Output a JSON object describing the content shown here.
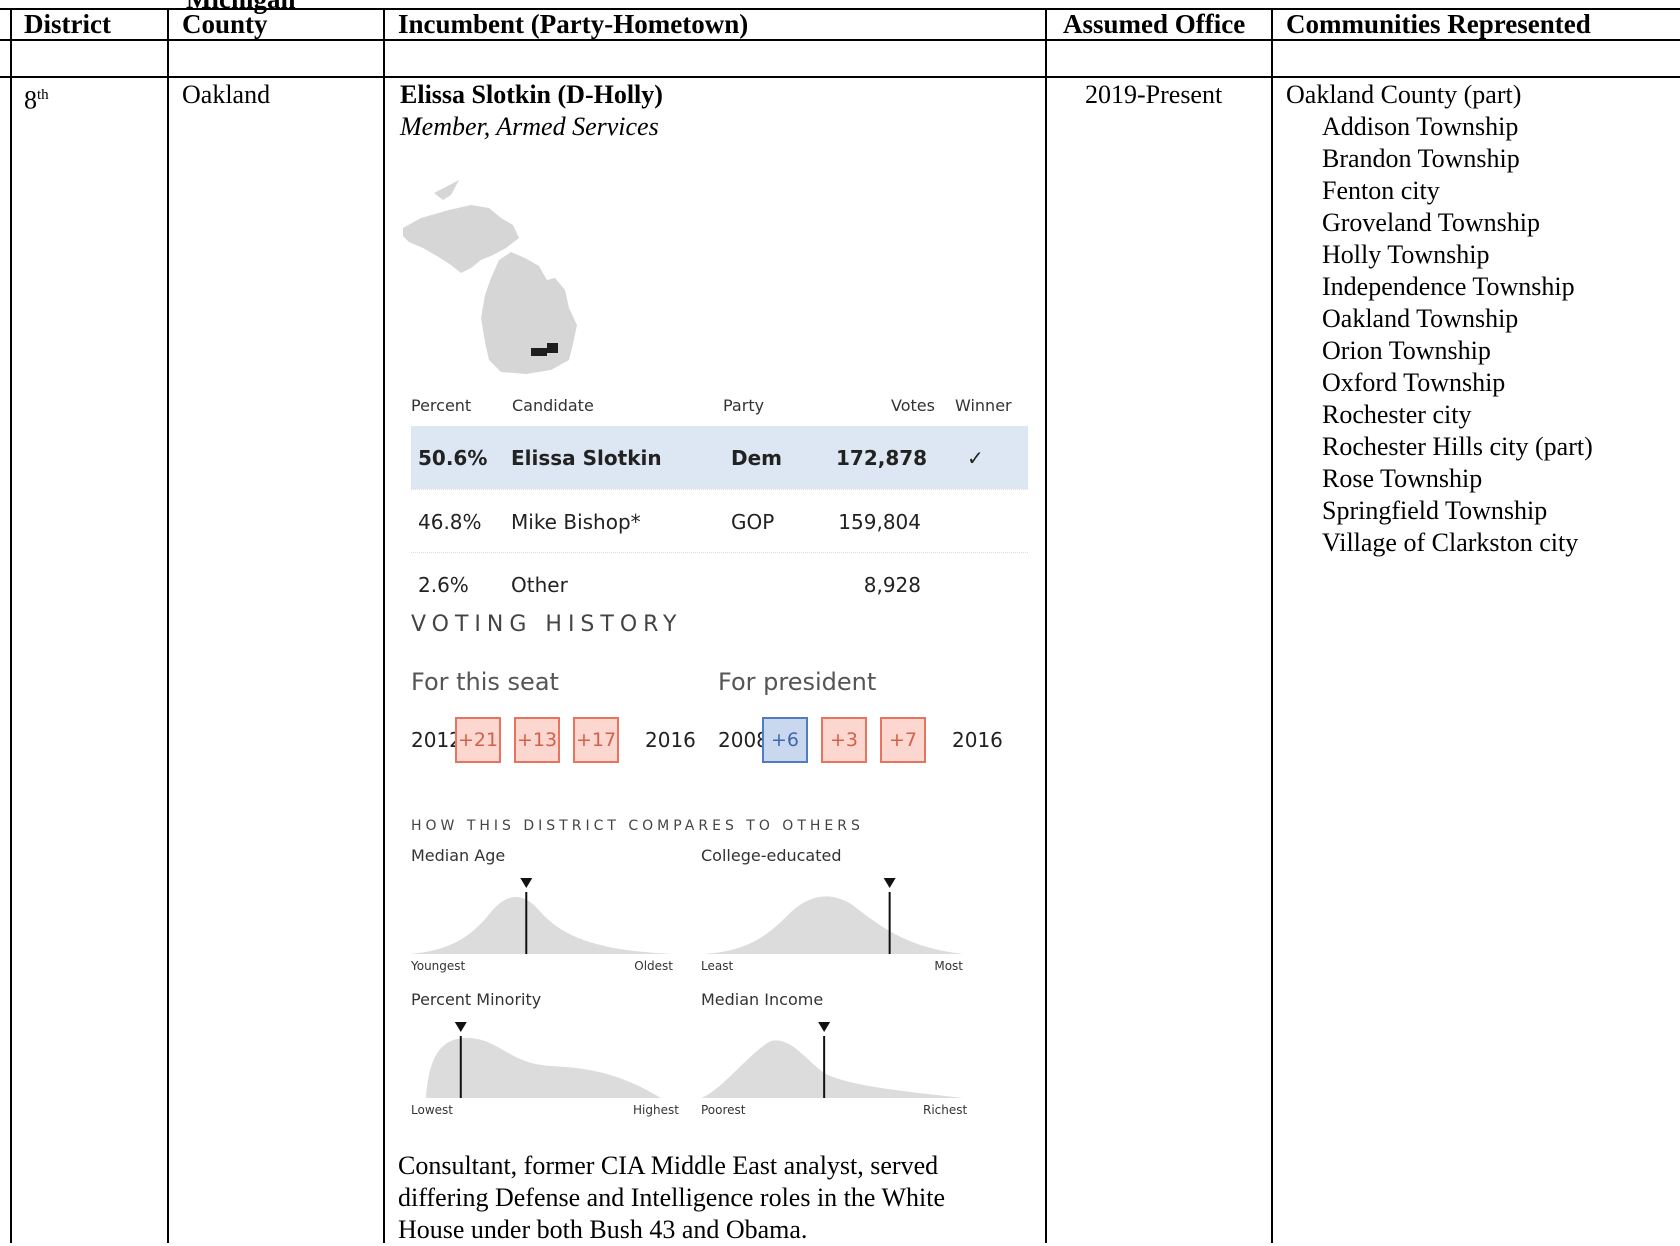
{
  "headers": {
    "partial_title": "Michigan",
    "district": "District",
    "county": "County",
    "incumbent": "Incumbent (Party-Hometown)",
    "assumed_office": "Assumed Office",
    "communities": "Communities Represented"
  },
  "row": {
    "district": "8",
    "district_sup": "th",
    "county": "Oakland",
    "incumbent_name": "Elissa Slotkin (D-Holly)",
    "committee": "Member, Armed Services",
    "assumed_office": "2019-Present",
    "communities": [
      {
        "text": "Oakland County (part)",
        "indent": false
      },
      {
        "text": "Addison Township",
        "indent": true
      },
      {
        "text": "Brandon Township",
        "indent": true
      },
      {
        "text": "Fenton city",
        "indent": true
      },
      {
        "text": "Groveland Township",
        "indent": true
      },
      {
        "text": "Holly Township",
        "indent": true
      },
      {
        "text": "Independence Township",
        "indent": true
      },
      {
        "text": "Oakland Township",
        "indent": true
      },
      {
        "text": "Orion Township",
        "indent": true
      },
      {
        "text": "Oxford Township",
        "indent": true
      },
      {
        "text": "Rochester city",
        "indent": true
      },
      {
        "text": "Rochester Hills city (part)",
        "indent": true
      },
      {
        "text": "Rose Township",
        "indent": true
      },
      {
        "text": "Springfield Township",
        "indent": true
      },
      {
        "text": "Village of Clarkston city",
        "indent": true
      }
    ],
    "bio_lines": [
      "Consultant, former CIA Middle East analyst, served",
      "differing Defense and Intelligence roles in the White",
      "House under both Bush 43 and Obama."
    ]
  },
  "results": {
    "headers": {
      "percent": "Percent",
      "candidate": "Candidate",
      "party": "Party",
      "votes": "Votes",
      "winner": "Winner"
    },
    "rows": [
      {
        "percent": "50.6%",
        "candidate": "Elissa Slotkin",
        "party": "Dem",
        "votes": "172,878",
        "winner": "✓"
      },
      {
        "percent": "46.8%",
        "candidate": "Mike Bishop*",
        "party": "GOP",
        "votes": "159,804",
        "winner": ""
      },
      {
        "percent": "2.6%",
        "candidate": "Other",
        "party": "",
        "votes": "8,928",
        "winner": ""
      }
    ],
    "highlight_color": "#dde7f3"
  },
  "voting_history": {
    "title": "VOTING HISTORY",
    "seat": {
      "label": "For this seat",
      "start": "2012",
      "end": "2016",
      "margins": [
        {
          "text": "+21",
          "party": "rep"
        },
        {
          "text": "+13",
          "party": "rep"
        },
        {
          "text": "+17",
          "party": "rep"
        }
      ]
    },
    "president": {
      "label": "For president",
      "start": "2008",
      "end": "2016",
      "margins": [
        {
          "text": "+6",
          "party": "dem"
        },
        {
          "text": "+3",
          "party": "rep"
        },
        {
          "text": "+7",
          "party": "rep"
        }
      ]
    },
    "colors": {
      "rep": "#e8735f",
      "dem": "#4f7dc4"
    }
  },
  "compare": {
    "title": "HOW THIS DISTRICT COMPARES TO OTHERS",
    "charts": [
      {
        "label": "Median Age",
        "low": "Youngest",
        "high": "Oldest",
        "marker": 0.44
      },
      {
        "label": "College-educated",
        "low": "Least",
        "high": "Most",
        "marker": 0.72
      },
      {
        "label": "Percent Minority",
        "low": "Lowest",
        "high": "Highest",
        "marker": 0.19
      },
      {
        "label": "Median Income",
        "low": "Poorest",
        "high": "Richest",
        "marker": 0.47
      }
    ]
  }
}
